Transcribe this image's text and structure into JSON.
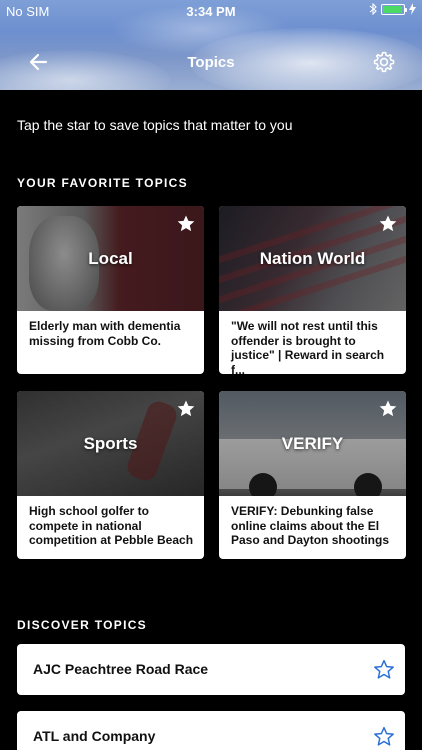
{
  "status_bar": {
    "carrier": "No SIM",
    "time": "3:34 PM",
    "battery_level": 0.95,
    "battery_color": "#4cd964"
  },
  "nav": {
    "title": "Topics",
    "back_icon": "back-arrow-icon",
    "settings_icon": "gear-icon"
  },
  "intro_text": "Tap the star to save topics that matter to you",
  "favorites": {
    "title": "YOUR FAVORITE TOPICS",
    "cards": [
      {
        "topic": "Local",
        "headline": "Elderly man with dementia missing from Cobb Co.",
        "starred": true
      },
      {
        "topic": "Nation World",
        "headline": "\"We will not rest until this offender is brought to justice\" | Reward in search f...",
        "starred": true
      },
      {
        "topic": "Sports",
        "headline": "High school golfer to compete in national competition at Pebble Beach",
        "starred": true
      },
      {
        "topic": "VERIFY",
        "headline": "VERIFY: Debunking false online claims about the El Paso and Dayton shootings",
        "starred": true
      }
    ]
  },
  "discover": {
    "title": "DISCOVER TOPICS",
    "items": [
      {
        "label": "AJC Peachtree Road Race",
        "starred": false
      },
      {
        "label": "ATL and Company",
        "starred": false
      }
    ]
  },
  "colors": {
    "background": "#000000",
    "star_outline": "#2a6fd6",
    "card_text": "#111111"
  }
}
